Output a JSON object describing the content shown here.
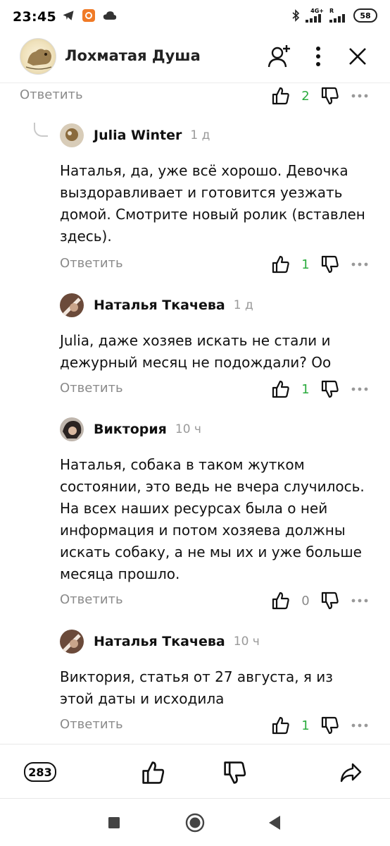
{
  "status_bar": {
    "time": "23:45",
    "network_label_top": "4G+",
    "network_label_roaming": "R",
    "battery": "58"
  },
  "header": {
    "channel_name": "Лохматая Душа"
  },
  "actions": {
    "reply_label": "Ответить"
  },
  "top_row": {
    "likes": "2"
  },
  "comments": [
    {
      "author": "Julia Winter",
      "time": "1 д",
      "text": "Наталья, да, уже всё хорошо. Девочка выздоравливает и готовится уезжать домой. Смотрите новый ролик (вставлен здесь).",
      "likes": "1"
    },
    {
      "author": "Наталья Ткачева",
      "time": "1 д",
      "text": "Julia, даже хозяев искать не стали и дежурный месяц не подождали? Оо",
      "likes": "1"
    },
    {
      "author": "Виктория",
      "time": "10 ч",
      "text": "Наталья, собака в таком жутком состоянии, это ведь не вчера случилось. На всех наших ресурсах была о ней информация и потом хозяева должны искать собаку, а не мы их и уже больше месяца прошло.",
      "likes": "0"
    },
    {
      "author": "Наталья Ткачева",
      "time": "10 ч",
      "text": "Виктория, статья от 27 августа, я из этой даты и исходила",
      "likes": "1"
    }
  ],
  "bottom_bar": {
    "comments_count": "283"
  },
  "icons": {
    "like": "thumbs-up-icon",
    "dislike": "thumbs-down-icon",
    "more": "more-dots-icon",
    "share": "share-icon",
    "subscribe": "add-user-icon",
    "menu": "kebab-icon",
    "close": "close-icon"
  },
  "colors": {
    "positive_count": "#2bab3e",
    "muted": "#8a8a8a"
  }
}
